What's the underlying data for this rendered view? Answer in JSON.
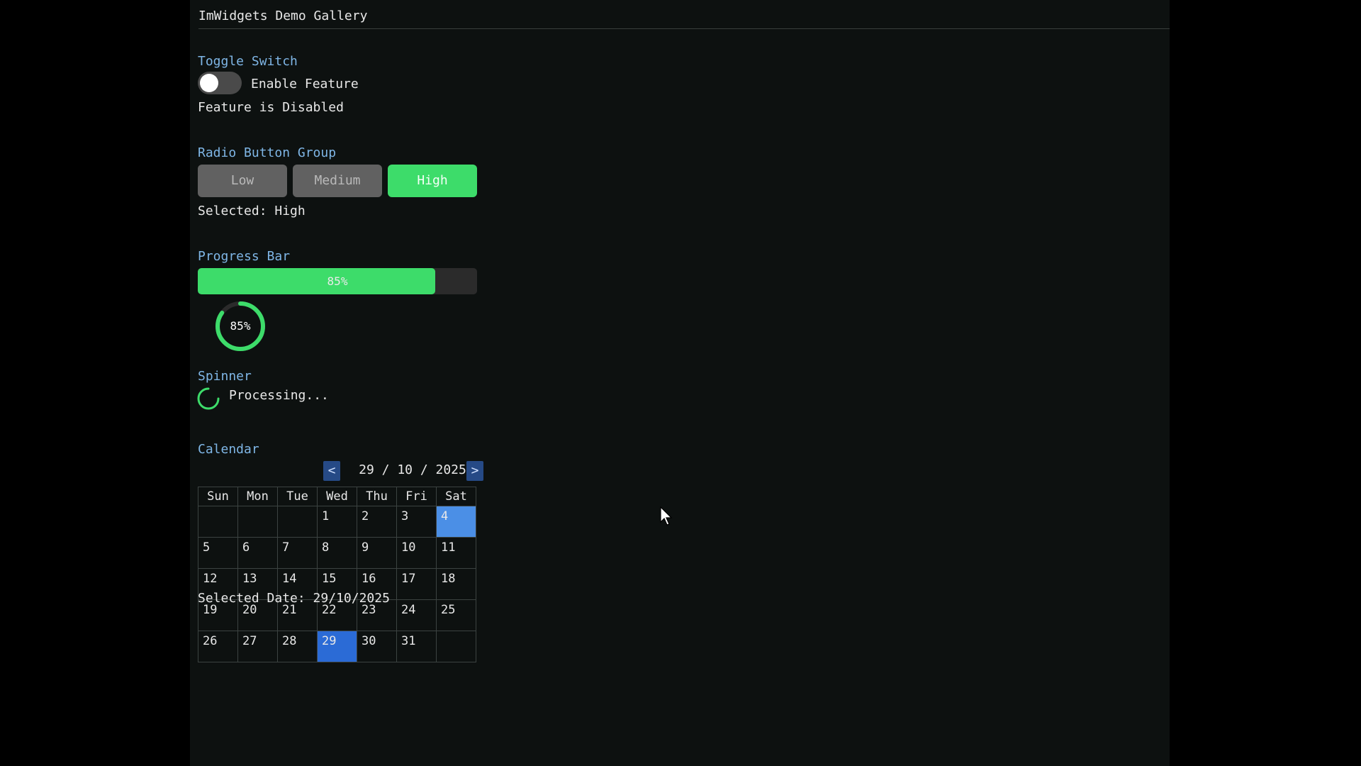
{
  "window": {
    "title": "ImWidgets Demo Gallery"
  },
  "toggle": {
    "section_label": "Toggle Switch",
    "label": "Enable Feature",
    "status": "Feature is Disabled",
    "enabled": false
  },
  "radio": {
    "section_label": "Radio Button Group",
    "options": [
      "Low",
      "Medium",
      "High"
    ],
    "selected": "High",
    "selected_text": "Selected: High"
  },
  "progress": {
    "section_label": "Progress Bar",
    "value": 0.85,
    "bar_label": "85%",
    "ring_label": "85%"
  },
  "spinner": {
    "section_label": "Spinner",
    "label": "Processing..."
  },
  "calendar": {
    "section_label": "Calendar",
    "prev_label": "<",
    "next_label": ">",
    "date_display": "29 / 10 / 2025",
    "weekdays": [
      "Sun",
      "Mon",
      "Tue",
      "Wed",
      "Thu",
      "Fri",
      "Sat"
    ],
    "weeks": [
      [
        "",
        "",
        "",
        "1",
        "2",
        "3",
        "4"
      ],
      [
        "5",
        "6",
        "7",
        "8",
        "9",
        "10",
        "11"
      ],
      [
        "12",
        "13",
        "14",
        "15",
        "16",
        "17",
        "18"
      ],
      [
        "19",
        "20",
        "21",
        "22",
        "23",
        "24",
        "25"
      ],
      [
        "26",
        "27",
        "28",
        "29",
        "30",
        "31",
        ""
      ]
    ],
    "selected_day": "29",
    "hovered_day": "4",
    "selected_date_text": "Selected Date: 29/10/2025"
  },
  "colors": {
    "accent_green": "#3ddc6a",
    "section_label": "#7fb6e6",
    "calendar_selected": "#2b6bd6",
    "calendar_hover": "#4b8fe6"
  }
}
